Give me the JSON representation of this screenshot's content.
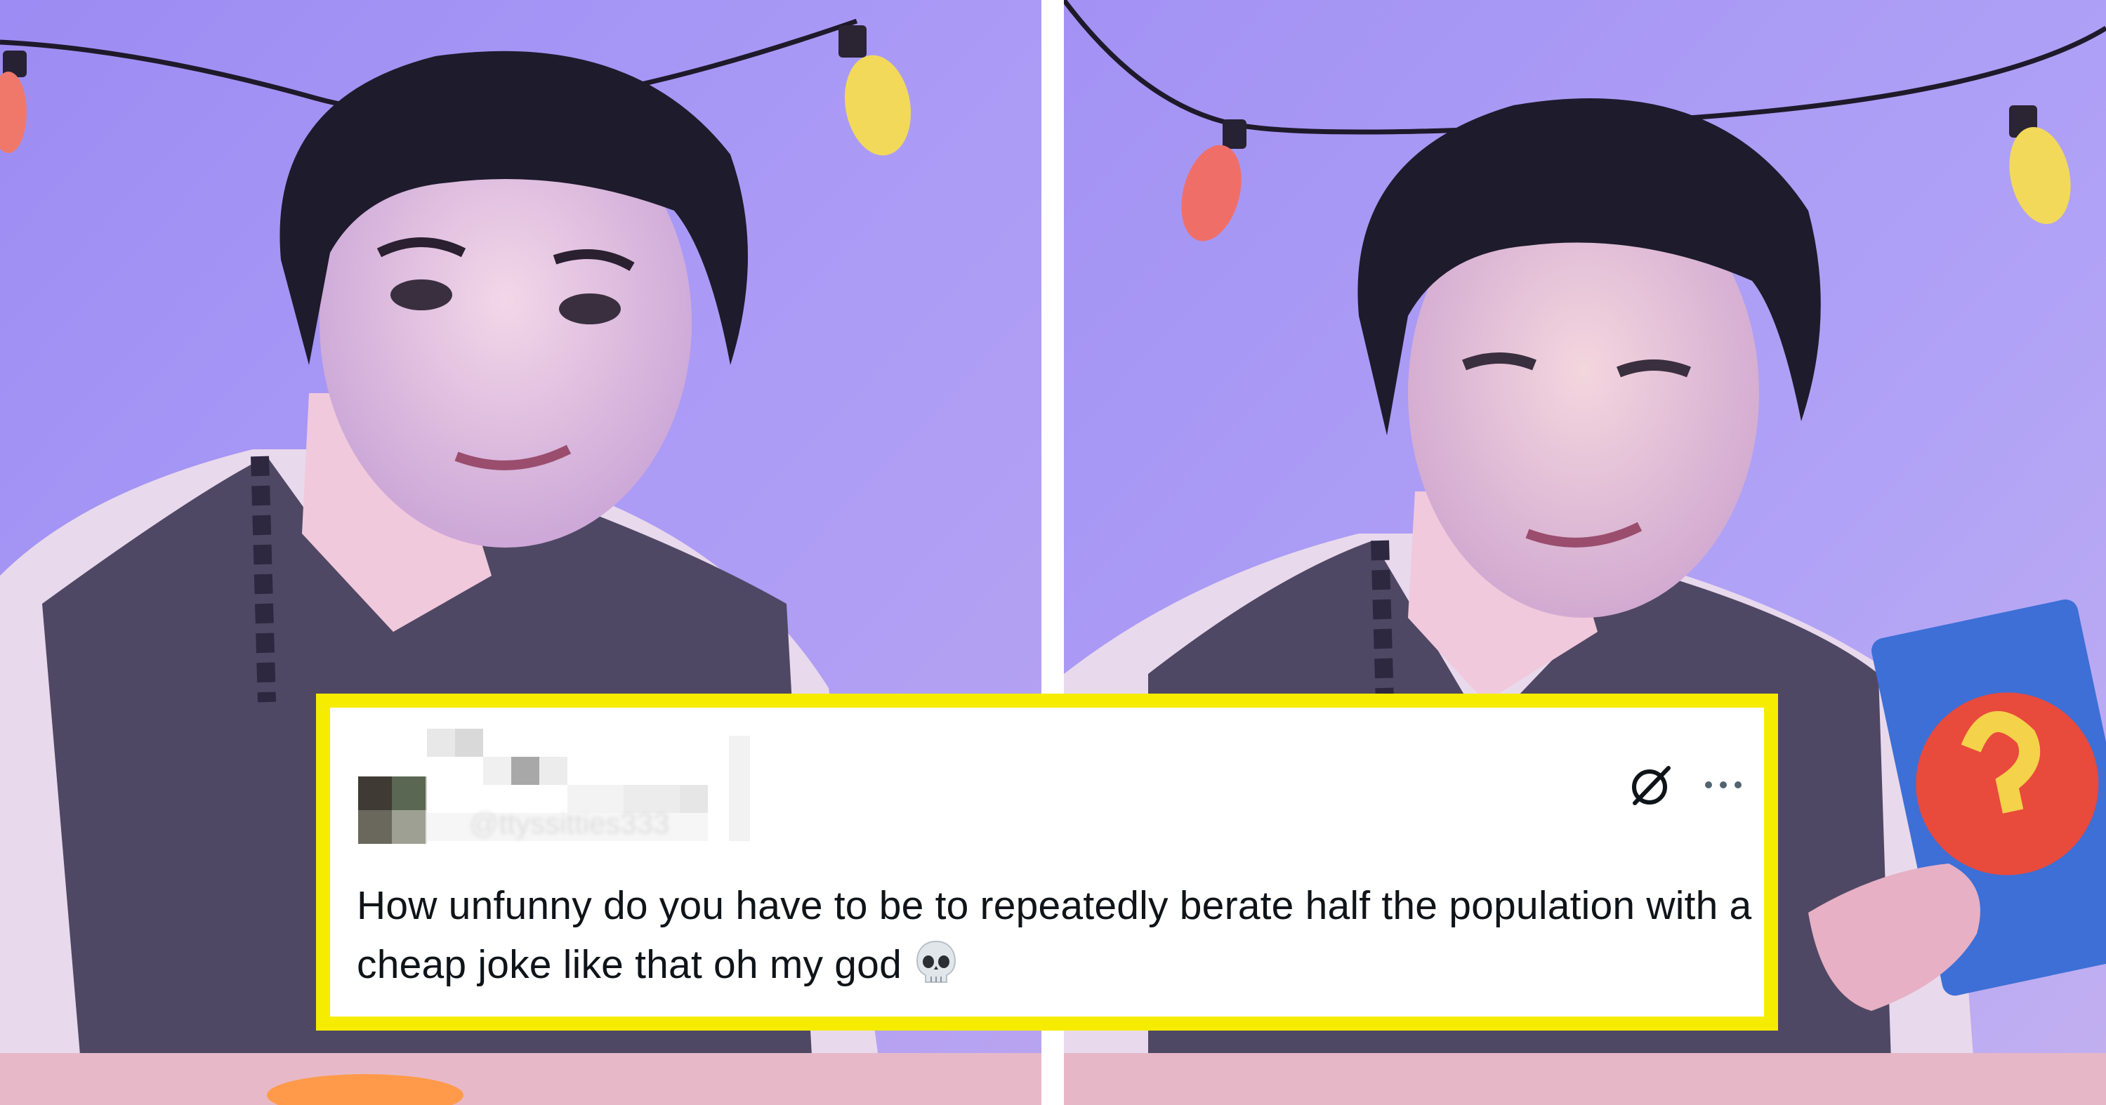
{
  "tweet": {
    "handle": "@ttyssitties333",
    "text": "How unfunny do you have to be to repeatedly berate half the population with a cheap joke like that oh my god",
    "emoji": "skull-emoji",
    "actions": {
      "grok_icon": "grok-icon",
      "more_icon": "more-options-icon"
    }
  },
  "colors": {
    "highlight_border": "#f6ec00",
    "background_purple": "#a694f2",
    "text": "#0f1419"
  }
}
